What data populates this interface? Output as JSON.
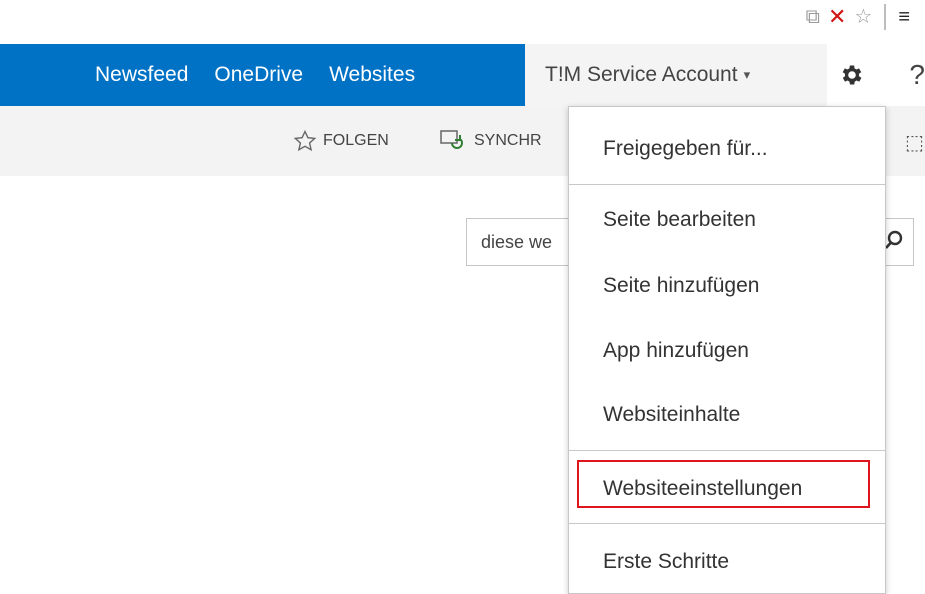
{
  "browser": {
    "icons": [
      "popup-icon",
      "close-x-icon",
      "star-outline-icon",
      "menu-icon"
    ]
  },
  "suitebar": {
    "links": [
      "Newsfeed",
      "OneDrive",
      "Websites"
    ],
    "account_name": "T!M Service Account",
    "account_caret": "▾",
    "help_glyph": "?",
    "colors": {
      "bar": "#0072c6",
      "account_bg": "#f4f4f4"
    }
  },
  "ribbon": {
    "follow_label": "FOLGEN",
    "sync_label": "SYNCHR"
  },
  "search": {
    "placeholder": "diese we"
  },
  "menu": {
    "items": [
      "Freigegeben für...",
      "Seite bearbeiten",
      "Seite hinzufügen",
      "App hinzufügen",
      "Websiteinhalte",
      "Websiteeinstellungen",
      "Erste Schritte"
    ],
    "highlighted_index": 5,
    "highlight_color": "#e0141e"
  }
}
